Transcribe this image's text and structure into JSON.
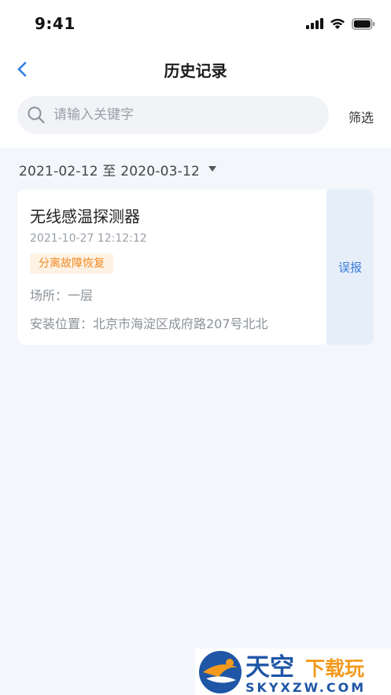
{
  "status_bar": {
    "time": "9:41"
  },
  "nav": {
    "title": "历史记录"
  },
  "search": {
    "placeholder": "请输入关键字",
    "value": "",
    "filter_label": "筛选"
  },
  "date_range": {
    "label": "2021-02-12 至 2020-03-12"
  },
  "records": [
    {
      "title": "无线感温探测器",
      "time": "2021-10-27 12:12:12",
      "tag": "分离故障恢复",
      "place": "场所：一层",
      "address": "安装位置：北京市海淀区成府路207号北北",
      "action_label": "误报"
    }
  ],
  "watermark": {
    "name_cn": "天空",
    "suffix_cn": "下载玩",
    "domain": "SKYXZW.COM"
  },
  "colors": {
    "accent": "#3a7ddb",
    "tag_text": "#f08a24",
    "tag_bg": "#fdf2e3",
    "action_bg": "#e6eef9",
    "page_bg": "#f3f6fa"
  },
  "icons": {
    "back": "chevron-left-icon",
    "search": "search-icon",
    "dropdown": "triangle-down-icon",
    "signal": "signal-icon",
    "wifi": "wifi-icon",
    "battery": "battery-icon"
  }
}
